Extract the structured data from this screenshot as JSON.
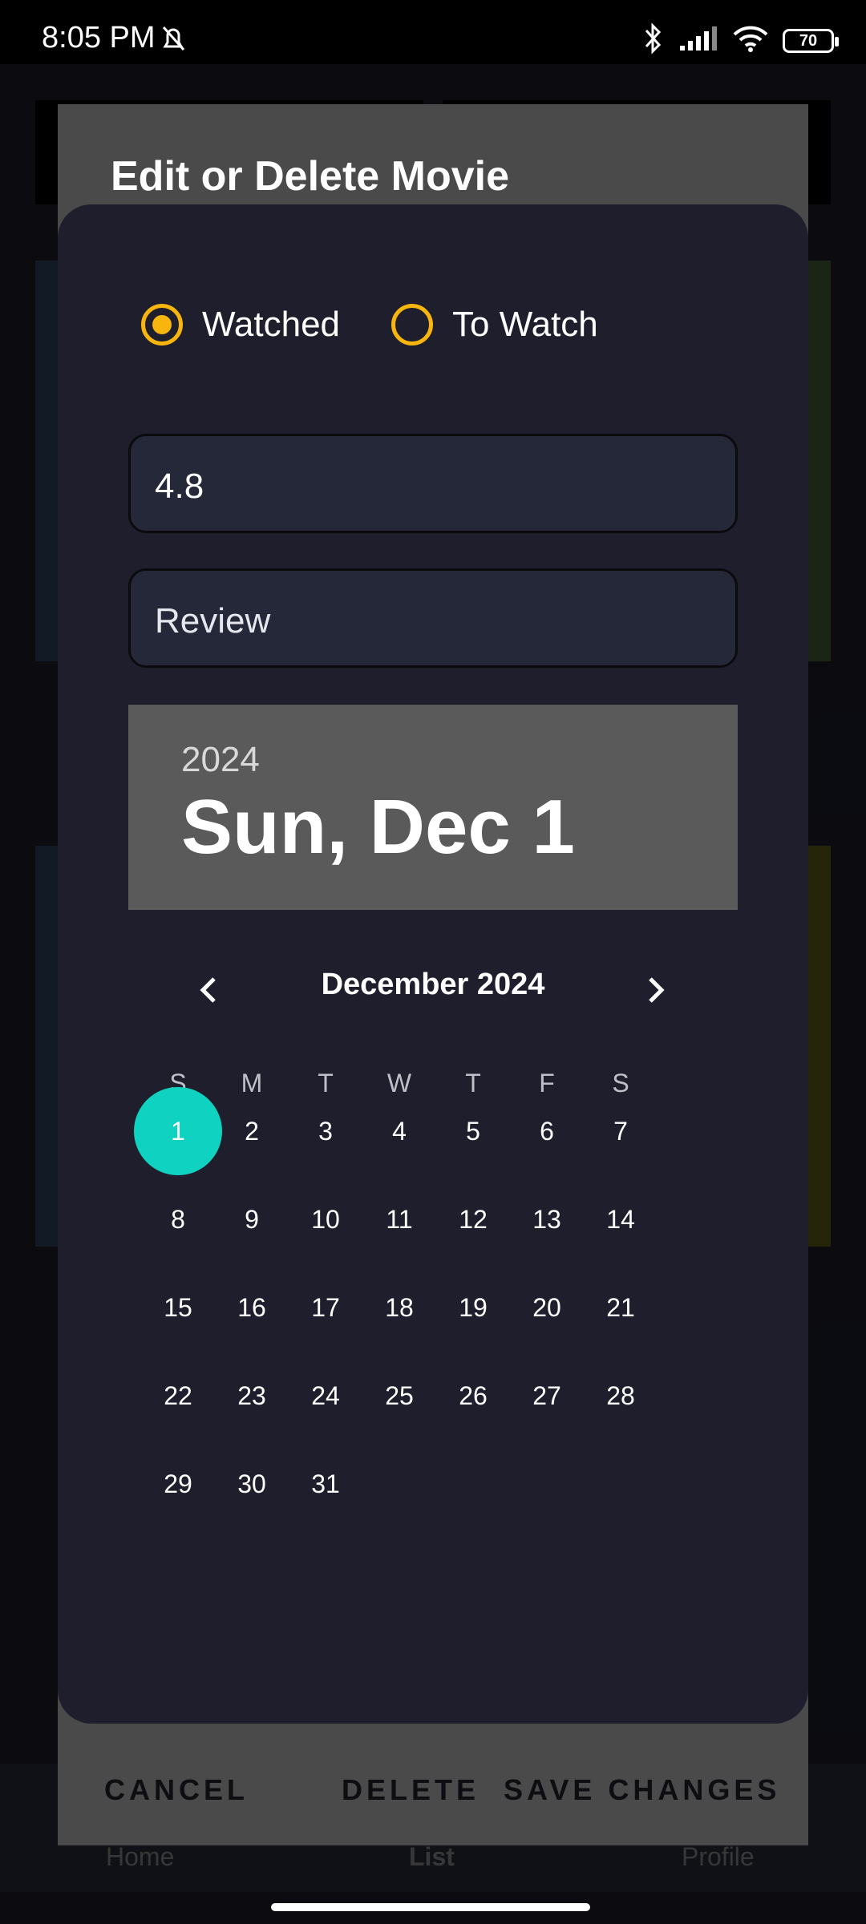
{
  "status_bar": {
    "time": "8:05 PM",
    "battery": "70"
  },
  "background_nav": {
    "home": "Home",
    "list": "List",
    "profile": "Profile"
  },
  "dialog": {
    "title": "Edit or Delete Movie",
    "status_options": [
      {
        "label": "Watched",
        "checked": true
      },
      {
        "label": "To Watch",
        "checked": false
      }
    ],
    "rating_value": "4.8",
    "review_placeholder": "Review",
    "date_picker": {
      "year": "2024",
      "selected_date_label": "Sun, Dec 1",
      "month_label": "December 2024",
      "weekdays": [
        "S",
        "M",
        "T",
        "W",
        "T",
        "F",
        "S"
      ],
      "days": [
        "1",
        "2",
        "3",
        "4",
        "5",
        "6",
        "7",
        "8",
        "9",
        "10",
        "11",
        "12",
        "13",
        "14",
        "15",
        "16",
        "17",
        "18",
        "19",
        "20",
        "21",
        "22",
        "23",
        "24",
        "25",
        "26",
        "27",
        "28",
        "29",
        "30",
        "31"
      ],
      "first_weekday_index": 0,
      "selected_day": "1",
      "accent_color": "#0fd2c0"
    },
    "actions": {
      "cancel": "CANCEL",
      "delete": "DELETE",
      "save": "SAVE CHANGES"
    },
    "radio_color": "#f7b50d"
  }
}
